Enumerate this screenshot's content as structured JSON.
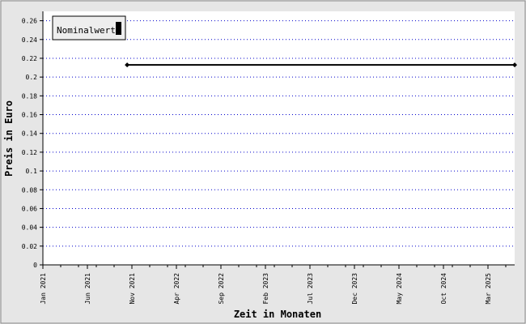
{
  "chart_data": {
    "type": "line",
    "title": "",
    "xlabel": "Zeit in Monaten",
    "ylabel": "Preis in Euro",
    "ylim": [
      0,
      0.27
    ],
    "xlim": [
      "2021-01",
      "2025-06"
    ],
    "y_ticks": [
      0,
      0.02,
      0.04,
      0.06,
      0.08,
      0.1,
      0.12,
      0.14,
      0.16,
      0.18,
      0.2,
      0.22,
      0.24,
      0.26
    ],
    "y_tick_labels": [
      "0",
      "0.02",
      "0.04",
      "0.06",
      "0.08",
      "0.1",
      "0.12",
      "0.14",
      "0.16",
      "0.18",
      "0.2",
      "0.22",
      "0.24",
      "0.26"
    ],
    "x_ticks": [
      "2021-01",
      "2021-06",
      "2021-11",
      "2022-04",
      "2022-09",
      "2023-02",
      "2023-07",
      "2023-12",
      "2024-05",
      "2024-10",
      "2025-03"
    ],
    "x_tick_labels": [
      "Jan 2021",
      "Jun 2021",
      "Nov 2021",
      "Apr 2022",
      "Sep 2022",
      "Feb 2023",
      "Jul 2023",
      "Dec 2023",
      "May 2024",
      "Oct 2024",
      "Mar 2025"
    ],
    "grid": true,
    "legend": "top-left",
    "series": [
      {
        "name": "Nominalwert",
        "color": "#000000",
        "x": [
          "2021-10-15",
          "2025-06"
        ],
        "y": [
          0.213,
          0.213
        ]
      }
    ]
  },
  "colors": {
    "background": "#e6e6e6",
    "plot_bg": "#ffffff",
    "grid": "#0000cc"
  }
}
